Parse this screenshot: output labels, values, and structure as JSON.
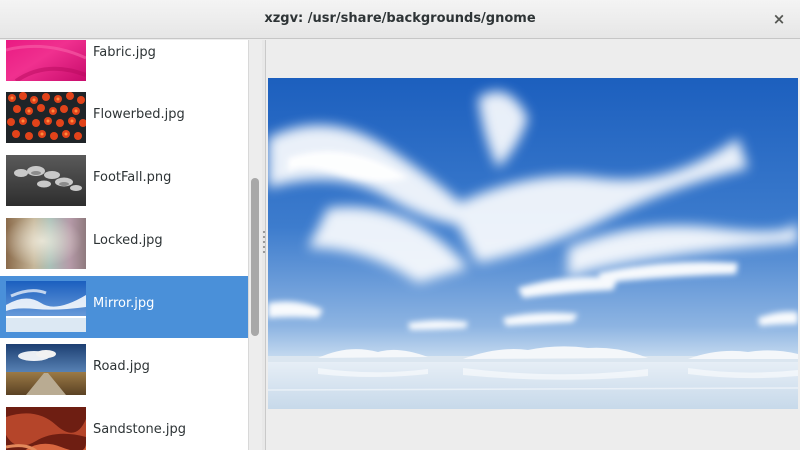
{
  "window": {
    "title": "xzgv: /usr/share/backgrounds/gnome",
    "close_icon": "close-icon",
    "close_glyph": "×"
  },
  "file_list": {
    "items": [
      {
        "name": "Fabric.jpg",
        "selected": false,
        "thumbnail": "pink-fabric"
      },
      {
        "name": "Flowerbed.jpg",
        "selected": false,
        "thumbnail": "orange-flowers"
      },
      {
        "name": "FootFall.png",
        "selected": false,
        "thumbnail": "gray-pebbles"
      },
      {
        "name": "Locked.jpg",
        "selected": false,
        "thumbnail": "pastel-gradient"
      },
      {
        "name": "Mirror.jpg",
        "selected": true,
        "thumbnail": "sky-reflection"
      },
      {
        "name": "Road.jpg",
        "selected": false,
        "thumbnail": "desert-road"
      },
      {
        "name": "Sandstone.jpg",
        "selected": false,
        "thumbnail": "red-sandstone"
      }
    ]
  },
  "viewer": {
    "image": "Mirror.jpg",
    "description": "blue sky with wispy clouds over reflective water"
  },
  "colors": {
    "selection": "#4a90d9",
    "sky_top": "#1b5fbf",
    "sky_mid": "#6aa0dc",
    "water": "#dbe7f2"
  }
}
